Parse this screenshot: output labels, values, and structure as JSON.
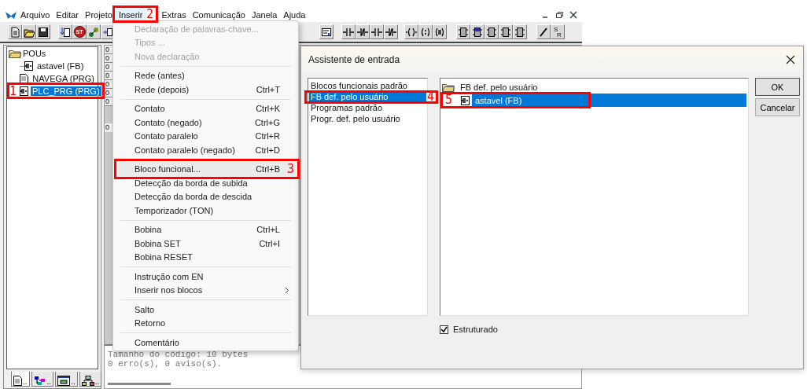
{
  "menu_bar": [
    {
      "label": "Arquivo",
      "selected": false
    },
    {
      "label": "Editar",
      "selected": false
    },
    {
      "label": "Projeto",
      "selected": false
    },
    {
      "label": "Inserir",
      "selected": true
    },
    {
      "label": "Extras",
      "selected": false
    },
    {
      "label": "Comunicação",
      "selected": false
    },
    {
      "label": "Janela",
      "selected": false
    },
    {
      "label": "Ajuda",
      "selected": false
    }
  ],
  "toolbar": [
    [
      {
        "kind": "new-file"
      },
      {
        "kind": "open-folder"
      },
      {
        "kind": "save"
      }
    ],
    [
      {
        "kind": "download"
      },
      {
        "kind": "stop",
        "label": "ST"
      },
      {
        "kind": "connect"
      },
      {
        "kind": "insert"
      }
    ],
    [
      {
        "kind": "list"
      }
    ],
    [
      {
        "kind": "contact"
      },
      {
        "kind": "contact-negated"
      },
      {
        "kind": "contact"
      },
      {
        "kind": "contact-negated"
      }
    ],
    [
      {
        "kind": "coil"
      },
      {
        "kind": "coil-set"
      },
      {
        "kind": "coil-reset"
      }
    ],
    [
      {
        "kind": "block"
      },
      {
        "kind": "block-marked"
      },
      {
        "kind": "block"
      },
      {
        "kind": "block"
      },
      {
        "kind": "block"
      }
    ],
    [
      {
        "kind": "line"
      },
      {
        "kind": "set-reset",
        "label": "S",
        "sublabel": "R"
      }
    ]
  ],
  "pou_tree": {
    "label": "POUs",
    "expanded": true,
    "children": [
      {
        "label": "astavel (FB)",
        "kind": "ladder",
        "selected": false
      },
      {
        "label": "NAVEGA (PRG)",
        "kind": "text",
        "selected": false
      },
      {
        "label": "PLC_PRG (PRG)",
        "kind": "ladder",
        "selected": true
      }
    ]
  },
  "object_tabs": [
    {
      "kind": "pous",
      "label": "..",
      "selected": true
    },
    {
      "kind": "types",
      "label": "..",
      "selected": false
    },
    {
      "kind": "visualizations",
      "label": "..",
      "selected": false
    },
    {
      "kind": "resources",
      "label": "..",
      "selected": false
    }
  ],
  "editor": {
    "gutter": [
      "0",
      "0",
      "0",
      "0",
      "0",
      "0",
      "0"
    ],
    "network_label": "0"
  },
  "messages": [
    "Tamanho do código: 10 bytes",
    "0 erro(s), 0 aviso(s)."
  ],
  "insert_menu": [
    [
      {
        "label": "Declaração de palavras-chave...",
        "disabled": true
      },
      {
        "label": "Tipos ...",
        "disabled": true
      },
      {
        "label": "Nova declaração",
        "disabled": true
      }
    ],
    [
      {
        "label": "Rede (antes)",
        "disabled": false
      },
      {
        "label": "Rede (depois)",
        "shortcut": "Ctrl+T",
        "disabled": false
      }
    ],
    [
      {
        "label": "Contato",
        "shortcut": "Ctrl+K",
        "disabled": false
      },
      {
        "label": "Contato (negado)",
        "shortcut": "Ctrl+G",
        "disabled": false
      },
      {
        "label": "Contato paralelo",
        "shortcut": "Ctrl+R",
        "disabled": false
      },
      {
        "label": "Contato paralelo (negado)",
        "shortcut": "Ctrl+D",
        "disabled": false
      }
    ],
    [
      {
        "label": "Bloco funcional...",
        "shortcut": "Ctrl+B",
        "disabled": false,
        "selected": true
      },
      {
        "label": "Detecção da borda de subida",
        "disabled": false
      },
      {
        "label": "Detecção da borda de descida",
        "disabled": false
      },
      {
        "label": "Temporizador (TON)",
        "disabled": false
      }
    ],
    [
      {
        "label": "Bobina",
        "shortcut": "Ctrl+L",
        "disabled": false
      },
      {
        "label": "Bobina SET",
        "shortcut": "Ctrl+I",
        "disabled": false
      },
      {
        "label": "Bobina RESET",
        "disabled": false
      }
    ],
    [
      {
        "label": "Instrução com EN",
        "disabled": false
      },
      {
        "label": "Inserir nos blocos",
        "submenu": true,
        "disabled": false
      }
    ],
    [
      {
        "label": "Salto",
        "disabled": false
      },
      {
        "label": "Retorno",
        "disabled": false
      }
    ],
    [
      {
        "label": "Comentário",
        "disabled": false
      }
    ]
  ],
  "dialog": {
    "title": "Assistente de entrada",
    "categories": [
      {
        "label": "Blocos funcionais padrão",
        "selected": false
      },
      {
        "label": "FB def. pelo usuário",
        "selected": true
      },
      {
        "label": "Programas padrão",
        "selected": false
      },
      {
        "label": "Progr. def. pelo usuário",
        "selected": false
      }
    ],
    "tree": {
      "label": "FB def. pelo usuário",
      "children": [
        {
          "label": "astavel (FB)",
          "selected": true
        }
      ]
    },
    "buttons": [
      "OK",
      "Cancelar"
    ],
    "structured": {
      "label": "Estruturado",
      "checked": true
    }
  },
  "annotations": [
    "1",
    "2",
    "3",
    "4",
    "5"
  ]
}
